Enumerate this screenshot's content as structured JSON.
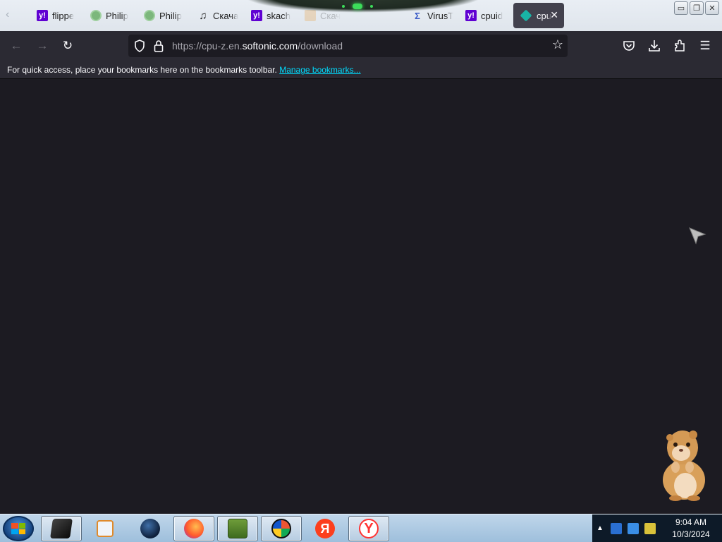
{
  "browser": {
    "tabs": [
      {
        "label": "flippe",
        "icon": "yahoo-icon"
      },
      {
        "label": "Philip",
        "icon": "green-globe-icon"
      },
      {
        "label": "Philip",
        "icon": "green-globe-icon"
      },
      {
        "label": "Скача",
        "icon": "music-note-icon"
      },
      {
        "label": "skach",
        "icon": "yahoo-icon"
      },
      {
        "label": "Скач",
        "icon": "orange-site-icon"
      },
      {
        "label": "VirusT",
        "icon": "virustotal-icon"
      },
      {
        "label": "cpuid",
        "icon": "yahoo-icon"
      },
      {
        "label": "cpu",
        "icon": "softonic-icon",
        "active": true
      }
    ],
    "url_prefix": "https://cpu-z.en.",
    "url_host": "softonic.com",
    "url_path": "/download",
    "bookmarks_message": "For quick access, place your bookmarks here on the bookmarks toolbar.",
    "manage_bookmarks_label": "Manage bookmarks..."
  },
  "window_controls": {
    "minimize": "▭",
    "restore": "❐",
    "close": "✕"
  },
  "taskbar": {
    "apps": [
      "terminal-app",
      "media-player-app",
      "globe-app",
      "firefox-app",
      "box-game-app",
      "color-wheel-app",
      "yandex-app",
      "yandex-browser-app"
    ]
  },
  "clock": {
    "time": "9:04 AM",
    "date": "10/3/2024"
  },
  "colors": {
    "page_bg": "#1c1b22",
    "toolbar_bg": "#2b2a33",
    "link": "#00ddff"
  }
}
